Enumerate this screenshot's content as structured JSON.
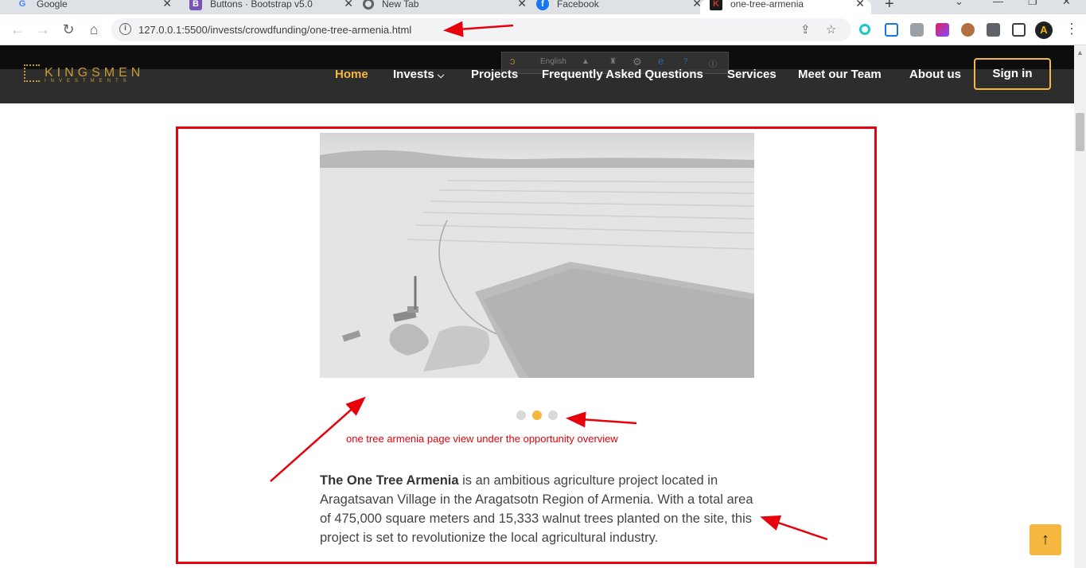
{
  "browser": {
    "tabs": [
      {
        "title": "Google",
        "favicon": "google-icon",
        "color": "#4285f4"
      },
      {
        "title": "Buttons · Bootstrap v5.0",
        "favicon": "bootstrap-icon",
        "color": "#7952b3"
      },
      {
        "title": "New Tab",
        "favicon": "chrome-icon",
        "color": "#5f6368"
      },
      {
        "title": "Facebook",
        "favicon": "facebook-icon",
        "color": "#1877f2"
      },
      {
        "title": "one-tree-armenia",
        "favicon": "kingsmen-icon",
        "color": "#c0392b",
        "active": true
      }
    ],
    "url": "127.0.0.1:5500/invests/crowdfunding/one-tree-armenia.html"
  },
  "site": {
    "logo": {
      "name": "KINGSMEN",
      "sub": "INVESTMENTS"
    },
    "translate_label": "English",
    "nav": [
      {
        "label": "Home",
        "active": true
      },
      {
        "label": "Invests",
        "dropdown": true
      },
      {
        "label": "Projects"
      },
      {
        "label": "Frequently Asked Questions"
      },
      {
        "label": "Services"
      },
      {
        "label": "Meet our Team"
      },
      {
        "label": "About us"
      }
    ],
    "signin_label": "Sign in",
    "accent": "#f5b740"
  },
  "content": {
    "annotation_caption": "one tree armenia page view under the opportunity overview",
    "carousel": {
      "slides": 3,
      "active_index": 1
    },
    "description_bold": "The One Tree Armenia",
    "description_rest": " is an ambitious agriculture project located in Aragatsavan Village in the Aragatsotn Region of Armenia. With a total area of 475,000 square meters and 15,333 walnut trees planted on the site, this project is set to revolutionize the local agricultural industry."
  },
  "annotation_color": "#e8000b"
}
